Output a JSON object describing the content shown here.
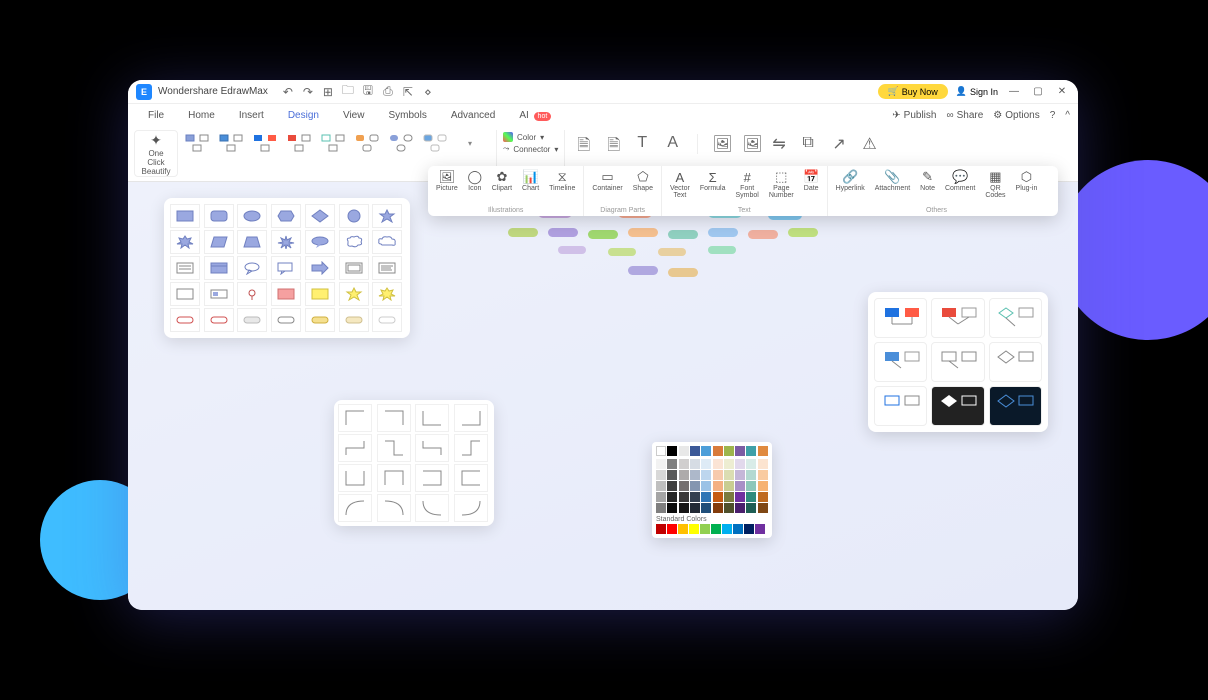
{
  "app": {
    "title": "Wondershare EdrawMax"
  },
  "titlebar": {
    "buy_now": "Buy Now",
    "sign_in": "Sign In"
  },
  "menu": {
    "file": "File",
    "home": "Home",
    "insert": "Insert",
    "design": "Design",
    "view": "View",
    "symbols": "Symbols",
    "advanced": "Advanced",
    "ai": "AI",
    "ai_badge": "hot",
    "publish": "Publish",
    "share": "Share",
    "options": "Options"
  },
  "ribbon": {
    "one_click_beautify": "One Click\nBeautify",
    "color": "Color",
    "connector": "Connector"
  },
  "floating": {
    "picture": "Picture",
    "icon": "Icon",
    "clipart": "Clipart",
    "chart": "Chart",
    "timeline": "Timeline",
    "illustrations": "Illustrations",
    "container": "Container",
    "shape": "Shape",
    "diagram_parts": "Diagram Parts",
    "vector_text": "Vector\nText",
    "formula": "Formula",
    "font_symbol": "Font\nSymbol",
    "page_number": "Page\nNumber",
    "date": "Date",
    "text": "Text",
    "hyperlink": "Hyperlink",
    "attachment": "Attachment",
    "note": "Note",
    "comment": "Comment",
    "qr_codes": "QR\nCodes",
    "plugin": "Plug-in",
    "others": "Others"
  },
  "color_panel": {
    "standard": "Standard Colors"
  },
  "colors": {
    "theme_row1": [
      "#ffffff",
      "#000000",
      "#e8e8e8",
      "#3b5998",
      "#4c9ed9",
      "#d97b3b",
      "#9db54c",
      "#7b5ca3",
      "#3fa0a8",
      "#e08a3f"
    ],
    "theme_grid": [
      [
        "#f2f2f2",
        "#7f7f7f",
        "#d0cece",
        "#d6dce4",
        "#deebf6",
        "#fbe4d5",
        "#ededd2",
        "#e2d9ec",
        "#d9ece8",
        "#fce4d0"
      ],
      [
        "#d8d8d8",
        "#595959",
        "#aeabab",
        "#adb8ca",
        "#bdd6ee",
        "#f7caac",
        "#dbddb2",
        "#c5b7d8",
        "#b3d9d1",
        "#f9cba1"
      ],
      [
        "#bfbfbf",
        "#3f3f3f",
        "#757070",
        "#8496b0",
        "#9bc2e6",
        "#f4b083",
        "#c9cd92",
        "#a88fc7",
        "#8dc7ba",
        "#f6b272"
      ],
      [
        "#a5a5a5",
        "#262626",
        "#3a3838",
        "#333f4f",
        "#2e75b5",
        "#c55a11",
        "#7b7c3f",
        "#7030a0",
        "#2e8b7d",
        "#bf6a1f"
      ],
      [
        "#7f7f7f",
        "#0c0c0c",
        "#171616",
        "#222a35",
        "#1f4e79",
        "#833c0c",
        "#4f502b",
        "#4a1f6d",
        "#1f5e54",
        "#7f4714"
      ]
    ],
    "standard": [
      "#c00000",
      "#ff0000",
      "#ffc000",
      "#ffff00",
      "#92d050",
      "#00b050",
      "#00b0f0",
      "#0070c0",
      "#002060",
      "#7030a0"
    ]
  }
}
